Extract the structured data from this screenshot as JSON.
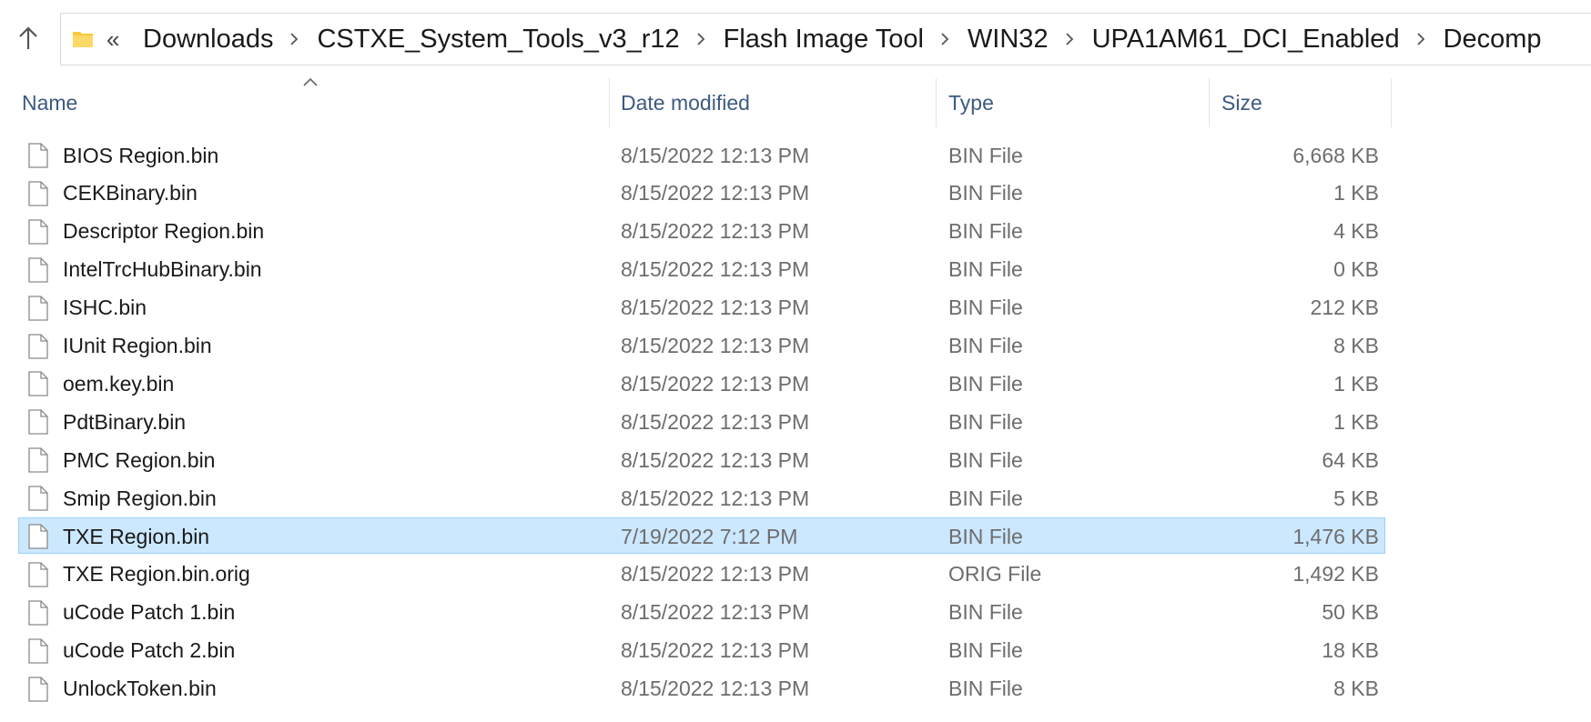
{
  "address_bar": {
    "overflow_glyph": "«",
    "breadcrumbs": [
      "Downloads",
      "CSTXE_System_Tools_v3_r12",
      "Flash Image Tool",
      "WIN32",
      "UPA1AM61_DCI_Enabled",
      "Decomp"
    ]
  },
  "columns": {
    "name": "Name",
    "date_modified": "Date modified",
    "type": "Type",
    "size": "Size"
  },
  "files": [
    {
      "name": "BIOS Region.bin",
      "date": "8/15/2022 12:13 PM",
      "type": "BIN File",
      "size": "6,668 KB"
    },
    {
      "name": "CEKBinary.bin",
      "date": "8/15/2022 12:13 PM",
      "type": "BIN File",
      "size": "1 KB"
    },
    {
      "name": "Descriptor Region.bin",
      "date": "8/15/2022 12:13 PM",
      "type": "BIN File",
      "size": "4 KB"
    },
    {
      "name": "IntelTrcHubBinary.bin",
      "date": "8/15/2022 12:13 PM",
      "type": "BIN File",
      "size": "0 KB"
    },
    {
      "name": "ISHC.bin",
      "date": "8/15/2022 12:13 PM",
      "type": "BIN File",
      "size": "212 KB"
    },
    {
      "name": "IUnit Region.bin",
      "date": "8/15/2022 12:13 PM",
      "type": "BIN File",
      "size": "8 KB"
    },
    {
      "name": "oem.key.bin",
      "date": "8/15/2022 12:13 PM",
      "type": "BIN File",
      "size": "1 KB"
    },
    {
      "name": "PdtBinary.bin",
      "date": "8/15/2022 12:13 PM",
      "type": "BIN File",
      "size": "1 KB"
    },
    {
      "name": "PMC Region.bin",
      "date": "8/15/2022 12:13 PM",
      "type": "BIN File",
      "size": "64 KB"
    },
    {
      "name": "Smip Region.bin",
      "date": "8/15/2022 12:13 PM",
      "type": "BIN File",
      "size": "5 KB"
    },
    {
      "name": "TXE Region.bin",
      "date": "7/19/2022 7:12 PM",
      "type": "BIN File",
      "size": "1,476 KB",
      "selected": true
    },
    {
      "name": "TXE Region.bin.orig",
      "date": "8/15/2022 12:13 PM",
      "type": "ORIG File",
      "size": "1,492 KB"
    },
    {
      "name": "uCode Patch 1.bin",
      "date": "8/15/2022 12:13 PM",
      "type": "BIN File",
      "size": "50 KB"
    },
    {
      "name": "uCode Patch 2.bin",
      "date": "8/15/2022 12:13 PM",
      "type": "BIN File",
      "size": "18 KB"
    },
    {
      "name": "UnlockToken.bin",
      "date": "8/15/2022 12:13 PM",
      "type": "BIN File",
      "size": "8 KB"
    }
  ],
  "icons": {
    "up": "up-arrow-icon",
    "folder": "folder-icon",
    "file": "file-icon",
    "sort": "sort-ascending-icon"
  },
  "colors": {
    "selection_bg": "#cce8ff",
    "selection_border": "#99d1ff",
    "header_text": "#3d5a80",
    "folder_yellow": "#f8c93a"
  }
}
